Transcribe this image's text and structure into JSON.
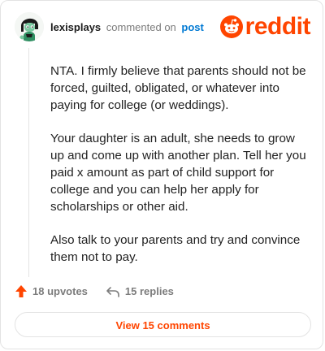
{
  "comment": {
    "username": "lexisplays",
    "commented_on": "commented on",
    "post_link": "post",
    "paragraphs": [
      "NTA. I firmly believe that parents should not be forced, guilted, obligated, or whatever into paying for college (or weddings).",
      "Your daughter is an adult, she needs to grow up and come up with another plan. Tell her you paid x amount as part of child support for college and you can help her apply for scholarships or other aid.",
      "Also talk to your parents and try and convince them not to pay."
    ]
  },
  "brand": {
    "wordmark": "reddit",
    "color": "#ff4500"
  },
  "actions": {
    "upvotes": "18 upvotes",
    "replies": "15 replies",
    "view_comments": "View 15 comments"
  },
  "icons": {
    "avatar": "avatar-icon",
    "logo": "reddit-alien-icon",
    "upvote": "upvote-arrow-icon",
    "reply": "reply-arrow-icon"
  },
  "colors": {
    "accent": "#ff4500",
    "link": "#0079d3",
    "muted": "#7c7c7c"
  }
}
